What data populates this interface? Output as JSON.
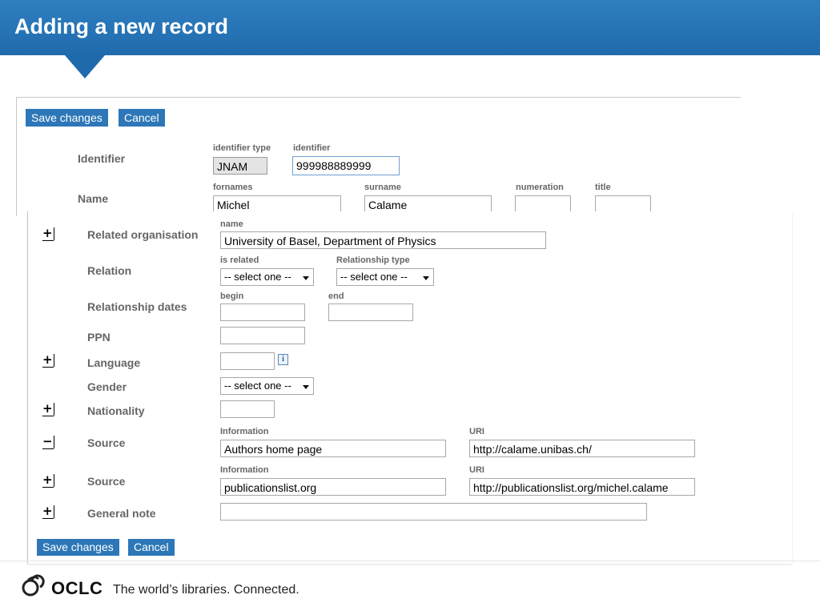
{
  "header": {
    "title": "Adding a new record"
  },
  "top_form": {
    "save_label": "Save changes",
    "cancel_label": "Cancel",
    "identifier": {
      "label": "Identifier",
      "type_label": "identifier type",
      "type_value": "JNAM",
      "id_label": "identifier",
      "id_value": "999988889999"
    },
    "name": {
      "label": "Name",
      "fornames_label": "fornames",
      "fornames_value": "Michel",
      "surname_label": "surname",
      "surname_value": "Calame",
      "numeration_label": "numeration",
      "numeration_value": "",
      "title_label": "title",
      "title_value": ""
    }
  },
  "bottom_form": {
    "related_org": {
      "toggle": "+",
      "label": "Related organisation",
      "name_label": "name",
      "name_value": "University of Basel, Department of Physics"
    },
    "relation": {
      "label": "Relation",
      "is_related_label": "is related",
      "is_related_value": "-- select one --",
      "rel_type_label": "Relationship type",
      "rel_type_value": "-- select one --"
    },
    "rel_dates": {
      "label": "Relationship dates",
      "begin_label": "begin",
      "begin_value": "",
      "end_label": "end",
      "end_value": ""
    },
    "ppn": {
      "label": "PPN",
      "value": ""
    },
    "language": {
      "toggle": "+",
      "label": "Language",
      "value": "",
      "info": "i"
    },
    "gender": {
      "label": "Gender",
      "value": "-- select one --"
    },
    "nationality": {
      "toggle": "+",
      "label": "Nationality",
      "value": ""
    },
    "source1": {
      "toggle": "−",
      "label": "Source",
      "info_label": "Information",
      "info_value": "Authors home page",
      "uri_label": "URI",
      "uri_value": "http://calame.unibas.ch/"
    },
    "source2": {
      "toggle": "+",
      "label": "Source",
      "info_label": "Information",
      "info_value": "publicationslist.org",
      "uri_label": "URI",
      "uri_value": "http://publicationslist.org/michel.calame"
    },
    "general_note": {
      "toggle": "+",
      "label": "General note",
      "value": ""
    },
    "save_label": "Save changes",
    "cancel_label": "Cancel"
  },
  "footer": {
    "brand": "OCLC",
    "tagline": "The world’s libraries. Connected."
  },
  "colors": {
    "accent": "#2d77b8",
    "header": "#1f6aad",
    "label": "#666666"
  }
}
